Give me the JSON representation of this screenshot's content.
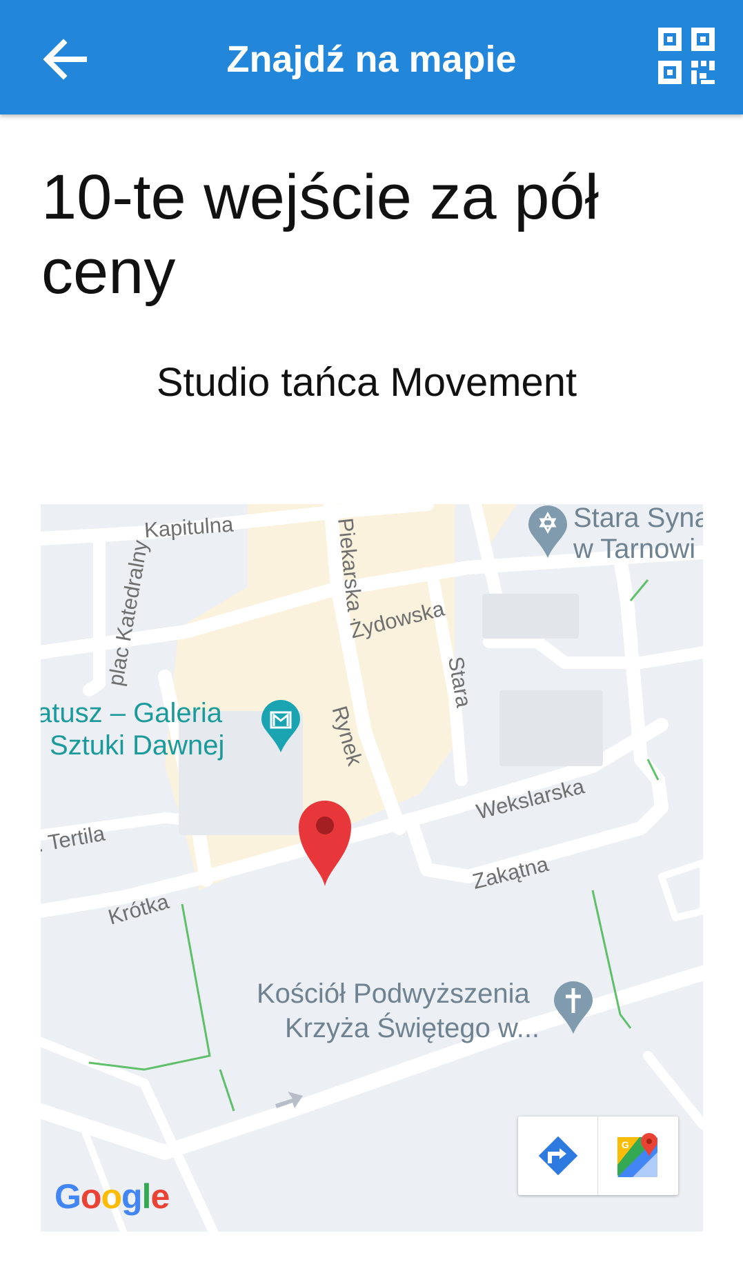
{
  "appbar": {
    "title": "Znajdź na mapie",
    "back_icon": "arrow-left-icon",
    "qr_icon": "qr-code-icon",
    "color": "#2286db"
  },
  "offer": {
    "title": "10-te wejście za pół ceny",
    "place": "Studio tańca Movement"
  },
  "map": {
    "streets": {
      "kapitulna": "Kapitulna",
      "plac_katedralny": "plac Katedralny",
      "piekarska": "Piekarska",
      "zydowska": "Żydowska",
      "stara": "Stara",
      "rynek": "Rynek",
      "wekslarska": "Wekslarska",
      "tertila": ". Tertila",
      "zakatna": "Zakątna",
      "krotka": "Krótka"
    },
    "pois": {
      "synagogue_line1": "Stara Syna",
      "synagogue_line2": "w Tarnowi",
      "ratusz_line1": "atusz – Galeria",
      "ratusz_line2": "Sztuki Dawnej",
      "church_line1": "Kościół Podwyższenia",
      "church_line2": "Krzyża Świętego w..."
    },
    "attribution": "Google",
    "buttons": {
      "directions_icon": "directions-icon",
      "open_maps_icon": "google-maps-icon"
    },
    "marker_icon": "location-pin-icon",
    "marker_color": "#e8373a",
    "poi_color": "#1a9a9a"
  }
}
